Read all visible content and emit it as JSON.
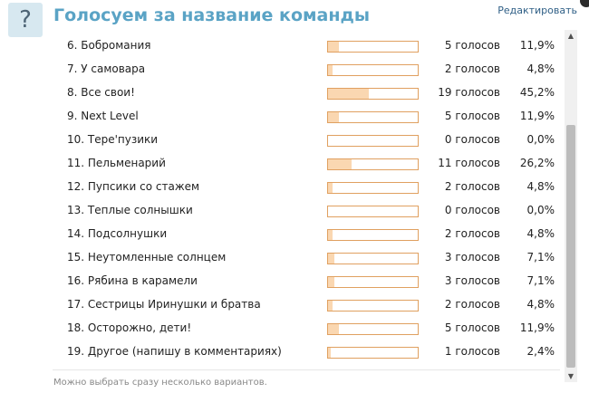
{
  "widget": {
    "icon_glyph": "?",
    "title": "Голосуем за название команды",
    "edit_label": "Редактировать",
    "footer_note": "Можно выбрать сразу несколько вариантов.",
    "colors": {
      "bar_border": "#e0a060",
      "bar_fill": "#fad7b1",
      "title": "#5aa3c5",
      "icon_bg": "#d7e8f0"
    }
  },
  "options": [
    {
      "label": "6. Бобромания",
      "votes": "5 голосов",
      "percent": "11,9%",
      "share": 11.9
    },
    {
      "label": "7. У самовара",
      "votes": "2 голосов",
      "percent": "4,8%",
      "share": 4.8
    },
    {
      "label": "8. Все свои!",
      "votes": "19 голосов",
      "percent": "45,2%",
      "share": 45.2
    },
    {
      "label": "9. Next Level",
      "votes": "5 голосов",
      "percent": "11,9%",
      "share": 11.9
    },
    {
      "label": "10. Тере'пузики",
      "votes": "0 голосов",
      "percent": "0,0%",
      "share": 0
    },
    {
      "label": "11. Пельменарий",
      "votes": "11 голосов",
      "percent": "26,2%",
      "share": 26.2
    },
    {
      "label": "12. Пупсики со стажем",
      "votes": "2 голосов",
      "percent": "4,8%",
      "share": 4.8
    },
    {
      "label": "13. Теплые солнышки",
      "votes": "0 голосов",
      "percent": "0,0%",
      "share": 0
    },
    {
      "label": "14. Подсолнушки",
      "votes": "2 голосов",
      "percent": "4,8%",
      "share": 4.8
    },
    {
      "label": "15. Неутомленные солнцем",
      "votes": "3 голосов",
      "percent": "7,1%",
      "share": 7.1
    },
    {
      "label": "16. Рябина в карамели",
      "votes": "3 голосов",
      "percent": "7,1%",
      "share": 7.1
    },
    {
      "label": "17. Сестрицы Иринушки и братва",
      "votes": "2 голосов",
      "percent": "4,8%",
      "share": 4.8
    },
    {
      "label": "18. Осторожно, дети!",
      "votes": "5 голосов",
      "percent": "11,9%",
      "share": 11.9
    },
    {
      "label": "19. Другое (напишу в комментариях)",
      "votes": "1 голосов",
      "percent": "2,4%",
      "share": 2.4
    }
  ],
  "scrollbar": {
    "up_icon": "▲",
    "down_icon": "▼"
  }
}
